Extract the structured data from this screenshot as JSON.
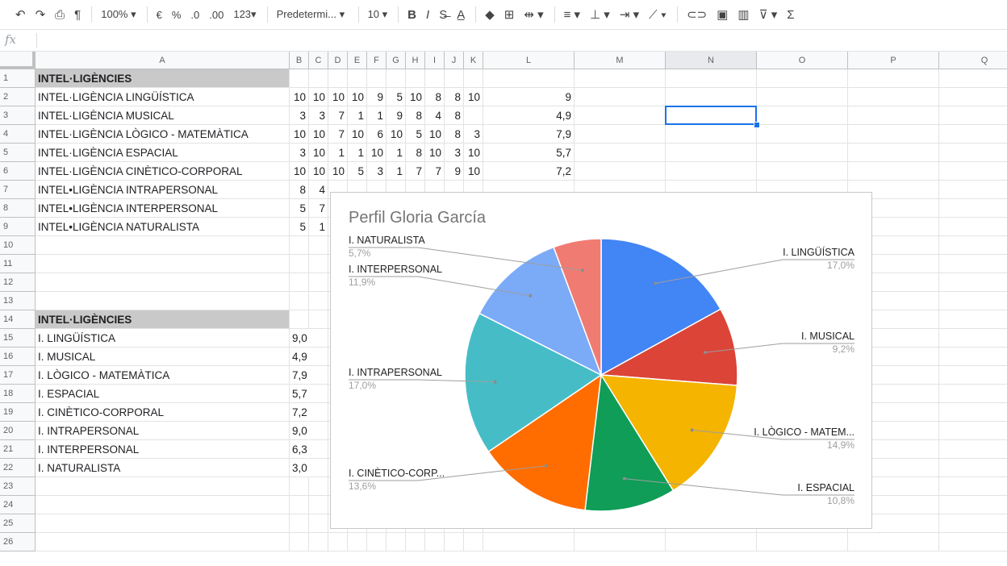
{
  "toolbar": [
    {
      "name": "undo-icon",
      "glyph": "↶",
      "kind": "icon"
    },
    {
      "name": "redo-icon",
      "glyph": "↷",
      "kind": "icon"
    },
    {
      "name": "print-icon",
      "glyph": "⎙",
      "kind": "icon"
    },
    {
      "name": "paint-format-icon",
      "glyph": "¶",
      "kind": "icon"
    },
    {
      "name": "sep",
      "glyph": "",
      "kind": "sep"
    },
    {
      "name": "zoom-select",
      "glyph": "100%  ▾",
      "kind": "text"
    },
    {
      "name": "sep",
      "glyph": "",
      "kind": "sep"
    },
    {
      "name": "currency-format-button",
      "glyph": "€",
      "kind": "text"
    },
    {
      "name": "percent-format-button",
      "glyph": "%",
      "kind": "text"
    },
    {
      "name": "decrease-decimals-button",
      "glyph": ".0",
      "kind": "text"
    },
    {
      "name": "increase-decimals-button",
      "glyph": ".00",
      "kind": "text"
    },
    {
      "name": "more-formats-button",
      "glyph": "123▾",
      "kind": "text"
    },
    {
      "name": "sep",
      "glyph": "",
      "kind": "sep"
    },
    {
      "name": "font-family-select",
      "glyph": "Predetermi...  ▾",
      "kind": "wide"
    },
    {
      "name": "sep",
      "glyph": "",
      "kind": "sep"
    },
    {
      "name": "font-size-select",
      "glyph": "10      ▾",
      "kind": "text"
    },
    {
      "name": "sep",
      "glyph": "",
      "kind": "sep"
    },
    {
      "name": "bold-button",
      "glyph": "B",
      "kind": "bold"
    },
    {
      "name": "italic-button",
      "glyph": "I",
      "kind": "ital"
    },
    {
      "name": "strikethrough-button",
      "glyph": "S̶",
      "kind": "icon"
    },
    {
      "name": "text-color-button",
      "glyph": "A̲",
      "kind": "icon"
    },
    {
      "name": "sep",
      "glyph": "",
      "kind": "sep"
    },
    {
      "name": "fill-color-icon",
      "glyph": "◆",
      "kind": "icon"
    },
    {
      "name": "borders-icon",
      "glyph": "⊞",
      "kind": "icon"
    },
    {
      "name": "merge-cells-icon",
      "glyph": "⇹ ▾",
      "kind": "icon"
    },
    {
      "name": "sep",
      "glyph": "",
      "kind": "sep"
    },
    {
      "name": "horizontal-align-icon",
      "glyph": "≡ ▾",
      "kind": "icon"
    },
    {
      "name": "vertical-align-icon",
      "glyph": "⊥ ▾",
      "kind": "icon"
    },
    {
      "name": "text-wrap-icon",
      "glyph": "⇥ ▾",
      "kind": "icon"
    },
    {
      "name": "text-rotation-icon",
      "glyph": "⟋ ▾",
      "kind": "icon"
    },
    {
      "name": "sep",
      "glyph": "",
      "kind": "sep"
    },
    {
      "name": "insert-link-icon",
      "glyph": "⊂⊃",
      "kind": "icon"
    },
    {
      "name": "insert-comment-icon",
      "glyph": "▣",
      "kind": "icon"
    },
    {
      "name": "insert-chart-icon",
      "glyph": "▥",
      "kind": "icon"
    },
    {
      "name": "filter-icon",
      "glyph": "⊽ ▾",
      "kind": "icon"
    },
    {
      "name": "functions-icon",
      "glyph": "Σ",
      "kind": "icon"
    }
  ],
  "formula_bar": {
    "fx_label": "fx",
    "value": ""
  },
  "columns": [
    {
      "label": "A",
      "w": 315
    },
    {
      "label": "B",
      "w": 24
    },
    {
      "label": "C",
      "w": 24
    },
    {
      "label": "D",
      "w": 24
    },
    {
      "label": "E",
      "w": 24
    },
    {
      "label": "F",
      "w": 24
    },
    {
      "label": "G",
      "w": 24
    },
    {
      "label": "H",
      "w": 24
    },
    {
      "label": "I",
      "w": 24
    },
    {
      "label": "J",
      "w": 24
    },
    {
      "label": "K",
      "w": 24
    },
    {
      "label": "L",
      "w": 113
    },
    {
      "label": "M",
      "w": 113
    },
    {
      "label": "N",
      "w": 113
    },
    {
      "label": "O",
      "w": 113
    },
    {
      "label": "P",
      "w": 113
    },
    {
      "label": "Q",
      "w": 113
    }
  ],
  "selected_column": "N",
  "selected_cell": {
    "row": 3,
    "col": "N"
  },
  "rows": [
    {
      "n": "1",
      "A": "INTEL·LIGÈNCIES",
      "hdr": true
    },
    {
      "n": "2",
      "A": "INTEL·LIGÈNCIA LINGÜÍSTICA",
      "vals": [
        "10",
        "10",
        "10",
        "10",
        "9",
        "5",
        "10",
        "8",
        "8",
        "10"
      ],
      "L": "9"
    },
    {
      "n": "3",
      "A": "INTEL·LIGÈNCIA MUSICAL",
      "vals": [
        "3",
        "3",
        "7",
        "1",
        "1",
        "9",
        "8",
        "4",
        "8",
        ""
      ],
      "L": "4,9"
    },
    {
      "n": "4",
      "A": "INTEL·LIGÈNCIA LÒGICO - MATEMÀTICA",
      "vals": [
        "10",
        "10",
        "7",
        "10",
        "6",
        "10",
        "5",
        "10",
        "8",
        "3"
      ],
      "L": "7,9"
    },
    {
      "n": "5",
      "A": "INTEL·LIGÈNCIA ESPACIAL",
      "vals": [
        "3",
        "10",
        "1",
        "1",
        "10",
        "1",
        "8",
        "10",
        "3",
        "10"
      ],
      "L": "5,7"
    },
    {
      "n": "6",
      "A": "INTEL·LIGÈNCIA CINÈTICO-CORPORAL",
      "vals": [
        "10",
        "10",
        "10",
        "5",
        "3",
        "1",
        "7",
        "7",
        "9",
        "10"
      ],
      "L": "7,2"
    },
    {
      "n": "7",
      "A": "INTEL•LIGÈNCIA INTRAPERSONAL",
      "vals": [
        "8",
        "4"
      ]
    },
    {
      "n": "8",
      "A": "INTEL•LIGÈNCIA INTERPERSONAL",
      "vals": [
        "5",
        "7"
      ]
    },
    {
      "n": "9",
      "A": "INTEL•LIGÈNCIA NATURALISTA",
      "vals": [
        "5",
        "1"
      ]
    },
    {
      "n": "10"
    },
    {
      "n": "11"
    },
    {
      "n": "12"
    },
    {
      "n": "13"
    },
    {
      "n": "14",
      "A": "INTEL·LIGÈNCIES",
      "hdr": true
    },
    {
      "n": "15",
      "A": "I. LINGÜÍSTICA",
      "B": "9,0"
    },
    {
      "n": "16",
      "A": "I. MUSICAL",
      "B": "4,9"
    },
    {
      "n": "17",
      "A": "I. LÒGICO - MATEMÀTICA",
      "B": "7,9"
    },
    {
      "n": "18",
      "A": "I. ESPACIAL",
      "B": "5,7"
    },
    {
      "n": "19",
      "A": "I. CINÈTICO-CORPORAL",
      "B": "7,2"
    },
    {
      "n": "20",
      "A": "I. INTRAPERSONAL",
      "B": "9,0"
    },
    {
      "n": "21",
      "A": "I. INTERPERSONAL",
      "B": "6,3"
    },
    {
      "n": "22",
      "A": "I. NATURALISTA",
      "B": "3,0"
    },
    {
      "n": "23"
    },
    {
      "n": "24"
    },
    {
      "n": "25"
    },
    {
      "n": "26"
    }
  ],
  "chart_data": {
    "type": "pie",
    "title": "Perfil Gloria García",
    "slices": [
      {
        "label": "I. LINGÜÍSTICA",
        "display_label": "I. LINGÜÍSTICA",
        "value": 9.0,
        "pct": "17,0%",
        "color": "#4285f4",
        "side": "right"
      },
      {
        "label": "I. MUSICAL",
        "display_label": "I. MUSICAL",
        "value": 4.9,
        "pct": "9,2%",
        "color": "#db4437",
        "side": "right"
      },
      {
        "label": "I. LÒGICO - MATEMÀTICA",
        "display_label": "I. LÒGICO - MATEM...",
        "value": 7.9,
        "pct": "14,9%",
        "color": "#f4b400",
        "side": "right"
      },
      {
        "label": "I. ESPACIAL",
        "display_label": "I. ESPACIAL",
        "value": 5.7,
        "pct": "10,8%",
        "color": "#0f9d58",
        "side": "right"
      },
      {
        "label": "I. CINÈTICO-CORPORAL",
        "display_label": "I. CINÈTICO-CORP...",
        "value": 7.2,
        "pct": "13,6%",
        "color": "#ff6d00",
        "side": "left"
      },
      {
        "label": "I. INTRAPERSONAL",
        "display_label": "I. INTRAPERSONAL",
        "value": 9.0,
        "pct": "17,0%",
        "color": "#46bdc6",
        "side": "left"
      },
      {
        "label": "I. INTERPERSONAL",
        "display_label": "I. INTERPERSONAL",
        "value": 6.3,
        "pct": "11,9%",
        "color": "#7baaf7",
        "side": "left"
      },
      {
        "label": "I. NATURALISTA",
        "display_label": "I. NATURALISTA",
        "value": 3.0,
        "pct": "5,7%",
        "color": "#f07b72",
        "side": "left"
      }
    ]
  }
}
